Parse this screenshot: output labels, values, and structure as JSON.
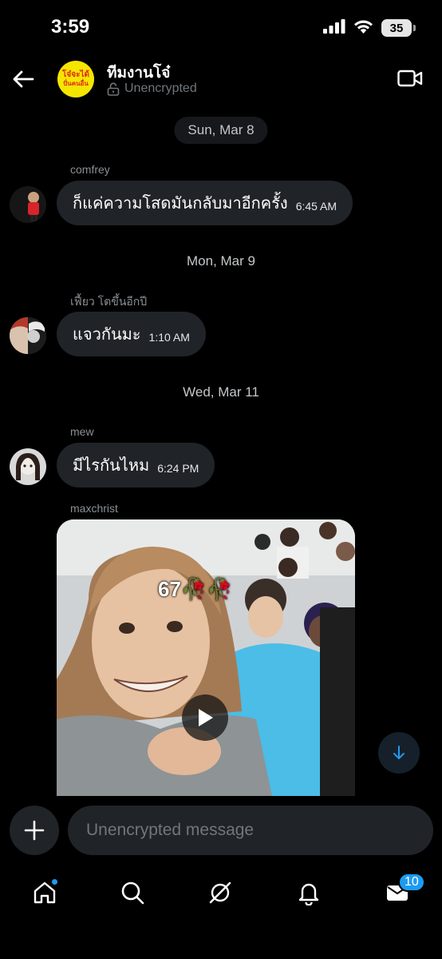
{
  "status_bar": {
    "time": "3:59",
    "battery": "35"
  },
  "header": {
    "group_name": "ทีมงานโจ๋",
    "encryption_label": "Unencrypted",
    "avatar_text_line1": "โจ๋จะได้",
    "avatar_text_line2": "ปั่นคนอื่น"
  },
  "messages": [
    {
      "date": "Sun, Mar 8",
      "sender": "comfrey",
      "text": "ก็แค่ความโสดมันกลับมาอีกครั้ง",
      "time": "6:45 AM"
    },
    {
      "date": "Mon, Mar 9",
      "sender": "เฟี้ยว โตขึ้นอีกปี",
      "text": "แจวกันมะ",
      "time": "1:10 AM"
    },
    {
      "date": "Wed, Mar 11",
      "sender": "mew",
      "text": "มีไรกันไหม",
      "time": "6:24 PM"
    }
  ],
  "media_message": {
    "sender": "maxchrist",
    "overlay_text": "67🥀🥀"
  },
  "composer": {
    "placeholder": "Unencrypted message"
  },
  "bottom_nav": {
    "messages_badge": "10"
  },
  "colors": {
    "accent": "#1d9bf0",
    "background": "#000000",
    "bubble": "#202327",
    "muted": "#71767b"
  }
}
